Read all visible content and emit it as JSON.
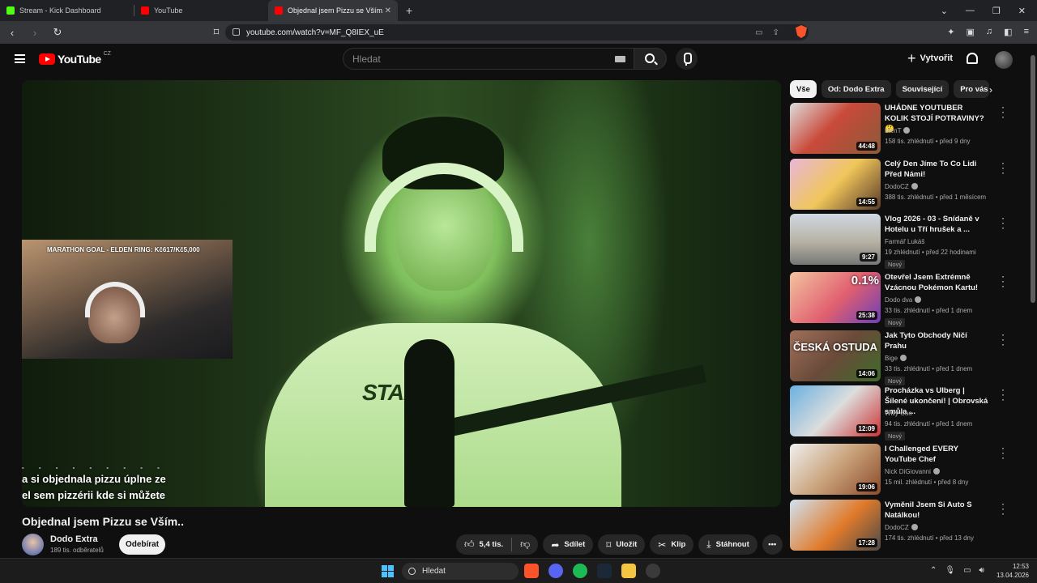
{
  "browser": {
    "tabs": [
      {
        "title": "Stream - Kick Dashboard",
        "color": "#53fc18"
      },
      {
        "title": "YouTube",
        "color": "#ff0000"
      },
      {
        "title": "Objednal jsem Pizzu se Vším.. - Y",
        "color": "#ff0000",
        "active": true
      }
    ],
    "url": "youtube.com/watch?v=MF_Q8IEX_uE"
  },
  "yt": {
    "logo_text": "YouTube",
    "region": "CZ",
    "search_placeholder": "Hledat",
    "create_label": "Vytvořit"
  },
  "player": {
    "overlay_goal": "MARATHON GOAL - ELDEN RING: Kč617/Kč5,000",
    "caption_line0": "- - - - - - - - -",
    "caption_line1": "a si objednala pizzu úplne ze",
    "caption_line2": "el sem pizzérii kde si    můžete",
    "shirt_text": "STARDE"
  },
  "video": {
    "title": "Objednal jsem Pizzu se Vším..",
    "channel": "Dodo Extra",
    "subscribers": "189 tis. odběratelů",
    "subscribe_label": "Odebírat",
    "likes": "5,4 tis.",
    "share_label": "Sdílet",
    "save_label": "Uložit",
    "clip_label": "Klip",
    "download_label": "Stáhnout"
  },
  "chips": [
    "Vše",
    "Od: Dodo Extra",
    "Související",
    "Pro vás"
  ],
  "recommendations": [
    {
      "title": "UHÁDNE YOUTUBER KOLIK STOJÍ POTRAVINY? 🤔",
      "channel": "MenT",
      "views": "158 tis. zhlédnutí",
      "age": "před 9 dny",
      "duration": "44:48",
      "new": "",
      "thumb": "linear-gradient(135deg,#ddd 0%,#c94a3a 45%,#8a5a3a 100%)",
      "thumb_text": "",
      "thumb_tag": ""
    },
    {
      "title": "Celý Den Jíme To Co Lidi Před Námi!",
      "channel": "DodoCZ",
      "views": "388 tis. zhlédnutí",
      "age": "před 1 měsícem",
      "duration": "14:55",
      "new": "",
      "thumb": "linear-gradient(135deg,#e8b7d8 0%,#f0c65a 50%,#5a3a2a 100%)",
      "thumb_text": "",
      "thumb_tag": ""
    },
    {
      "title": "Vlog 2026 - 03 - Snídaně v Hotelu u Tří hrušek a ...",
      "channel": "Farmář Lukáš",
      "views": "19 zhlédnutí",
      "age": "před 22 hodinami",
      "duration": "9:27",
      "new": "Nový",
      "thumb": "linear-gradient(180deg,#cfd8e3 0%,#b8b2a4 55%,#777 100%)",
      "thumb_text": "",
      "thumb_tag": ""
    },
    {
      "title": "Otevřel Jsem Extrémně Vzácnou Pokémon Kartu!",
      "channel": "Dodo dva",
      "views": "33 tis. zhlédnutí",
      "age": "před 1 dnem",
      "duration": "25:38",
      "new": "Nový",
      "thumb": "linear-gradient(135deg,#f3c3a0 0%,#e05f6f 55%,#6b3fb8 100%)",
      "thumb_text": "",
      "thumb_tag": "0.1%"
    },
    {
      "title": "Jak Tyto Obchody Ničí Prahu",
      "channel": "Bige",
      "views": "33 tis. zhlédnutí",
      "age": "před 1 dnem",
      "duration": "14:06",
      "new": "Nový",
      "thumb": "linear-gradient(135deg,#a0705a 0%,#6a4a3a 50%,#3f6b2a 100%)",
      "thumb_text": "ČESKÁ OSTUDA",
      "thumb_tag": ""
    },
    {
      "title": "Procházka vs Ulberg | Šílené ukončení! | Obrovská smůla ...",
      "channel": "Willy Cao",
      "views": "94 tis. zhlédnutí",
      "age": "před 1 dnem",
      "duration": "12:09",
      "new": "Nový",
      "thumb": "linear-gradient(135deg,#6ab0e0 0%,#ddd 50%,#c33 100%)",
      "thumb_text": "",
      "thumb_tag": ""
    },
    {
      "title": "I Challenged EVERY YouTube Chef",
      "channel": "Nick DiGiovanni",
      "views": "15 mil. zhlédnutí",
      "age": "před 8 dny",
      "duration": "19:06",
      "new": "",
      "thumb": "linear-gradient(135deg,#f0f0f0 0%,#c9a27a 50%,#8b4a2a 100%)",
      "thumb_text": "",
      "thumb_tag": ""
    },
    {
      "title": "Vyměnil Jsem Si Auto S Natálkou!",
      "channel": "DodoCZ",
      "views": "174 tis. zhlédnutí",
      "age": "před 13 dny",
      "duration": "17:28",
      "new": "",
      "thumb": "linear-gradient(135deg,#cfe3f3 0%,#e07a2a 55%,#4a4a4a 100%)",
      "thumb_text": "",
      "thumb_tag": ""
    }
  ],
  "taskbar": {
    "search_label": "Hledat",
    "time": "12:53",
    "date": "13.04.2026"
  }
}
